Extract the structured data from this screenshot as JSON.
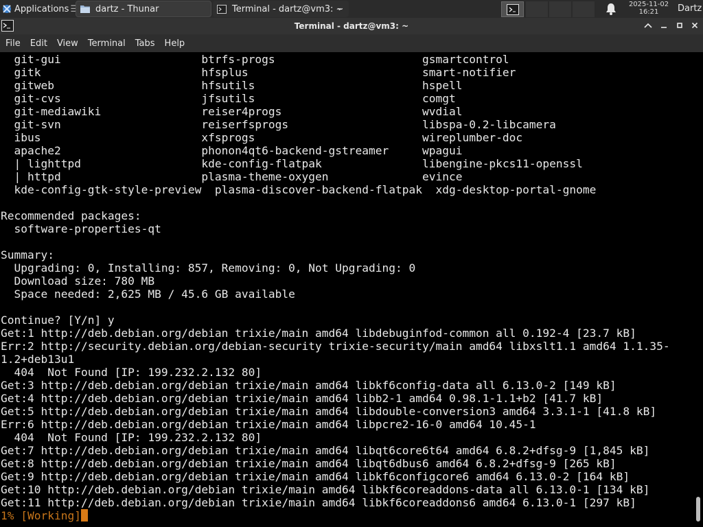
{
  "panel": {
    "apps_label": "Applications",
    "tasks": [
      {
        "label": "dartz - Thunar",
        "icon": "folder-icon"
      },
      {
        "label": "Terminal - dartz@vm3: ~",
        "icon": "terminal-icon"
      }
    ],
    "date": "2025-11-02",
    "time": "16:21",
    "user": "Dartz"
  },
  "window": {
    "title": "Terminal - dartz@vm3: ~"
  },
  "menu": [
    "File",
    "Edit",
    "View",
    "Terminal",
    "Tabs",
    "Help"
  ],
  "terminal": {
    "lines": [
      "  git-gui                     btrfs-progs                      gsmartcontrol",
      "  gitk                        hfsplus                          smart-notifier",
      "  gitweb                      hfsutils                         hspell",
      "  git-cvs                     jfsutils                         comgt",
      "  git-mediawiki               reiser4progs                     wvdial",
      "  git-svn                     reiserfsprogs                    libspa-0.2-libcamera",
      "  ibus                        xfsprogs                         wireplumber-doc",
      "  apache2                     phonon4qt6-backend-gstreamer     wpagui",
      "  | lighttpd                  kde-config-flatpak               libengine-pkcs11-openssl",
      "  | httpd                     plasma-theme-oxygen              evince",
      "  kde-config-gtk-style-preview  plasma-discover-backend-flatpak  xdg-desktop-portal-gnome",
      "",
      "Recommended packages:",
      "  software-properties-qt",
      "",
      "Summary:",
      "  Upgrading: 0, Installing: 857, Removing: 0, Not Upgrading: 0",
      "  Download size: 780 MB",
      "  Space needed: 2,625 MB / 45.6 GB available",
      "",
      "Continue? [Y/n] y",
      "Get:1 http://deb.debian.org/debian trixie/main amd64 libdebuginfod-common all 0.192-4 [23.7 kB]",
      "Err:2 http://security.debian.org/debian-security trixie-security/main amd64 libxslt1.1 amd64 1.1.35-",
      "1.2+deb13u1",
      "  404  Not Found [IP: 199.232.2.132 80]",
      "Get:3 http://deb.debian.org/debian trixie/main amd64 libkf6config-data all 6.13.0-2 [149 kB]",
      "Get:4 http://deb.debian.org/debian trixie/main amd64 libb2-1 amd64 0.98.1-1.1+b2 [41.7 kB]",
      "Get:5 http://deb.debian.org/debian trixie/main amd64 libdouble-conversion3 amd64 3.3.1-1 [41.8 kB]",
      "Err:6 http://deb.debian.org/debian trixie/main amd64 libpcre2-16-0 amd64 10.45-1",
      "  404  Not Found [IP: 199.232.2.132 80]",
      "Get:7 http://deb.debian.org/debian trixie/main amd64 libqt6core6t64 amd64 6.8.2+dfsg-9 [1,845 kB]",
      "Get:8 http://deb.debian.org/debian trixie/main amd64 libqt6dbus6 amd64 6.8.2+dfsg-9 [265 kB]",
      "Get:9 http://deb.debian.org/debian trixie/main amd64 libkf6configcore6 amd64 6.13.0-2 [164 kB]",
      "Get:10 http://deb.debian.org/debian trixie/main amd64 libkf6coreaddons-data all 6.13.0-1 [134 kB]",
      "Get:11 http://deb.debian.org/debian trixie/main amd64 libkf6coreaddons6 amd64 6.13.0-1 [297 kB]"
    ],
    "progress_line": "1% [Working]"
  },
  "colors": {
    "progress_text": "#c8761a",
    "cursor": "#d87a16"
  }
}
